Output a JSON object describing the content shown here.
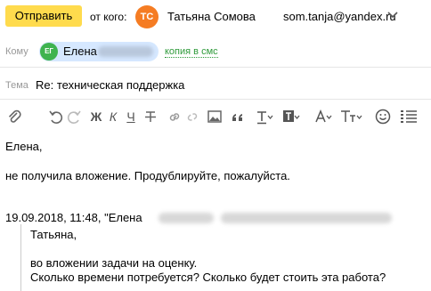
{
  "header": {
    "send_label": "Отправить",
    "from_label": "от кого:",
    "avatar_initials": "ТС",
    "avatar_color": "#f57c23",
    "from_name": "Татьяна Сомова",
    "from_email": "som.tanja@yandex.ru"
  },
  "to_row": {
    "label": "Кому",
    "recipient_initials": "ЕГ",
    "recipient_name": "Елена",
    "sms_link": "копия в смс"
  },
  "subject_row": {
    "label": "Тема",
    "value": "Re: техническая поддержка"
  },
  "toolbar": {
    "icons": [
      "attach-icon",
      "undo-icon",
      "redo-icon",
      "bold-icon",
      "italic-icon",
      "underline-icon",
      "strikethrough-icon",
      "link-icon",
      "unlink-icon",
      "image-icon",
      "quote-icon",
      "text-color-icon",
      "background-color-icon",
      "font-icon",
      "font-size-icon",
      "emoji-icon",
      "list-icon"
    ],
    "bold": "Ж",
    "italic": "К",
    "underline": "Ч"
  },
  "body": {
    "greeting": "Елена,",
    "message": "не получила вложение. Продублируйте, пожалуйста.",
    "quote_header": "19.09.2018, 11:48, \"Елена",
    "quote_greeting": "Татьяна,",
    "quote_line1": "во вложении задачи на оценку.",
    "quote_line2": "Сколько времени потребуется? Сколько будет стоить эта работа?"
  },
  "colors": {
    "send_button": "#ffdb4d",
    "recipient_chip": "#d6e8ff",
    "recipient_avatar": "#3fb34f",
    "sms_link": "#2e9a3a"
  }
}
